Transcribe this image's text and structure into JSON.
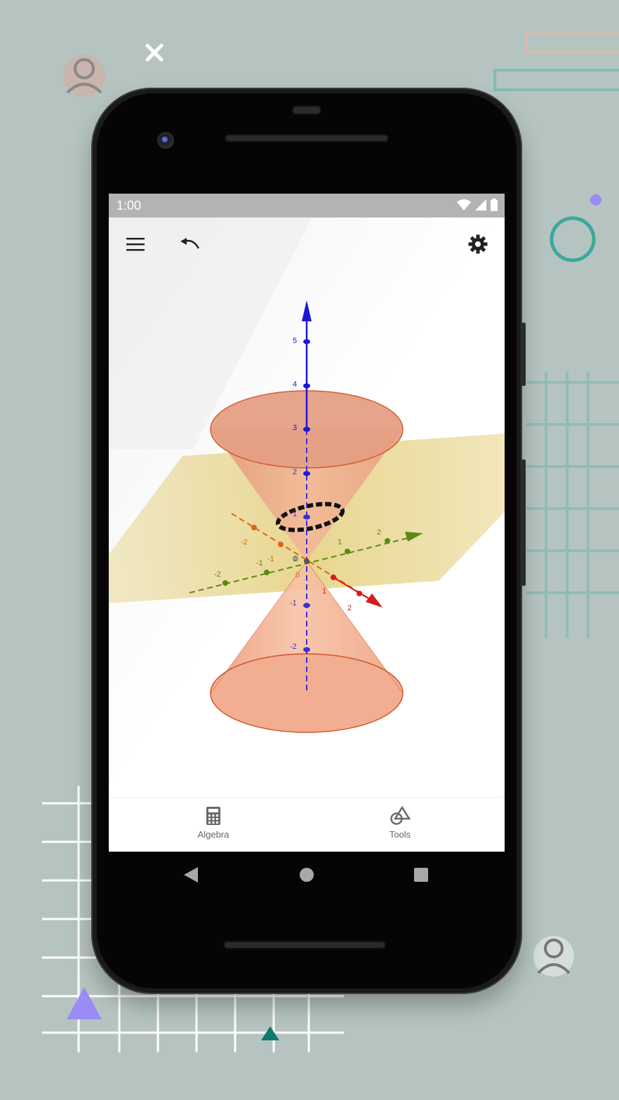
{
  "status_bar": {
    "time": "1:00"
  },
  "toolbar": {
    "menu_icon": "hamburger-menu-icon",
    "undo_icon": "undo-icon",
    "settings_icon": "gear-icon"
  },
  "graph": {
    "z_ticks": [
      "5",
      "4",
      "3",
      "2",
      "1",
      "-1",
      "-2"
    ],
    "x_ticks": [
      "-2",
      "-1",
      "0",
      "1",
      "2"
    ],
    "y_ticks": [
      "-2",
      "-1",
      "0",
      "1",
      "2"
    ],
    "origin_label": "0",
    "colors": {
      "z_axis": "#1f17d6",
      "x_axis": "#d81a1a",
      "y_axis": "#5a8a12",
      "cone": "#f0a27a",
      "plane": "#e6d48a"
    }
  },
  "bottom_nav": {
    "algebra": {
      "label": "Algebra",
      "icon": "calculator-icon"
    },
    "tools": {
      "label": "Tools",
      "icon": "shapes-icon"
    }
  },
  "system_nav": {
    "back": "back-icon",
    "home": "home-icon",
    "recents": "recents-icon"
  }
}
